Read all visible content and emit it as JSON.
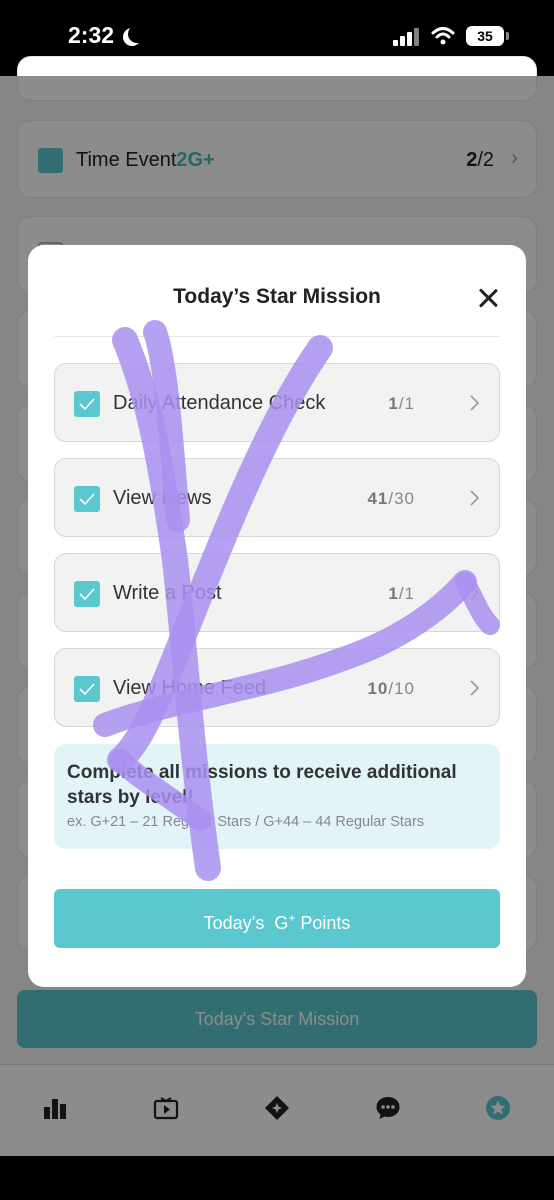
{
  "status_bar": {
    "time": "2:32",
    "battery": "35"
  },
  "background": {
    "time_event": {
      "label": "Time Event",
      "badge": "2G+",
      "done": "2",
      "total": "/2"
    },
    "mission_button": "Today's Star Mission"
  },
  "modal": {
    "title": "Today’s Star Mission",
    "missions": [
      {
        "label": "Daily Attendance Check",
        "done": "1",
        "total": "/1"
      },
      {
        "label": "View News",
        "done": "41",
        "total": "/30"
      },
      {
        "label": "Write a Post",
        "done": "1",
        "total": "/1"
      },
      {
        "label": "View Home Feed",
        "done": "10",
        "total": "/10"
      }
    ],
    "notice_title": "Complete all missions to receive additional stars by level!",
    "notice_sub": "ex. G+21 – 21 Regular Stars / G+44 – 44 Regular Stars",
    "points_prefix": "Today’s  G",
    "points_sup": "+",
    "points_suffix": " Points"
  },
  "colors": {
    "accent": "#5bc7cf",
    "scribble": "#a98ff0"
  }
}
